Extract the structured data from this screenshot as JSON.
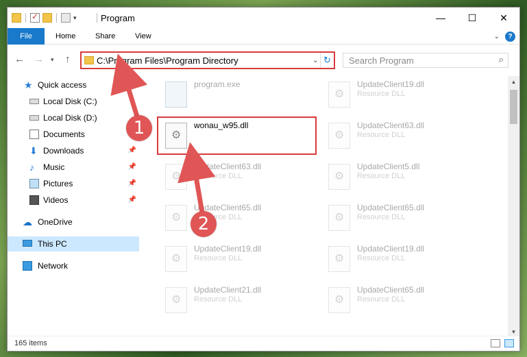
{
  "window": {
    "title": "Program",
    "controls": {
      "minimize": "—",
      "maximize": "☐",
      "close": "✕"
    }
  },
  "ribbon": {
    "tabs": [
      "File",
      "Home",
      "Share",
      "View"
    ],
    "help": "?"
  },
  "address": {
    "path": "C:\\Program Files\\Program Directory",
    "search_placeholder": "Search Program"
  },
  "nav_pane": {
    "items": [
      {
        "label": "Quick access",
        "icon": "star-icon",
        "pinned": false
      },
      {
        "label": "Local Disk (C:)",
        "icon": "drive-icon",
        "pinned": false
      },
      {
        "label": "Local Disk (D:)",
        "icon": "drive-icon",
        "pinned": false
      },
      {
        "label": "Documents",
        "icon": "documents-icon",
        "pinned": false
      },
      {
        "label": "Downloads",
        "icon": "download-icon",
        "pinned": true
      },
      {
        "label": "Music",
        "icon": "music-icon",
        "pinned": true
      },
      {
        "label": "Pictures",
        "icon": "pictures-icon",
        "pinned": true
      },
      {
        "label": "Videos",
        "icon": "videos-icon",
        "pinned": true
      },
      {
        "label": "OneDrive",
        "icon": "cloud-icon",
        "pinned": false
      },
      {
        "label": "This PC",
        "icon": "pc-icon",
        "pinned": false,
        "selected": true
      },
      {
        "label": "Network",
        "icon": "network-icon",
        "pinned": false
      }
    ]
  },
  "files": {
    "left": [
      {
        "name": "program.exe",
        "type": ""
      },
      {
        "name": "wonau_w95.dll",
        "type": ""
      },
      {
        "name": "UpdateClient63.dll",
        "type": "Resource DLL"
      },
      {
        "name": "UpdateClient65.dll",
        "type": "Resource DLL"
      },
      {
        "name": "UpdateClient19.dll",
        "type": "Resource DLL"
      },
      {
        "name": "UpdateClient21.dll",
        "type": "Resource DLL"
      }
    ],
    "right": [
      {
        "name": "UpdateClient19.dll",
        "type": "Resource DLL"
      },
      {
        "name": "UpdateClient63.dll",
        "type": "Resource DLL"
      },
      {
        "name": "UpdateClient5.dll",
        "type": "Resource DLL"
      },
      {
        "name": "UpdateClient65.dll",
        "type": "Resource DLL"
      },
      {
        "name": "UpdateClient19.dll",
        "type": "Resource DLL"
      },
      {
        "name": "UpdateClient65.dll",
        "type": "Resource DLL"
      }
    ]
  },
  "status": {
    "count": "165 items"
  },
  "annotations": {
    "step1": "1",
    "step2": "2",
    "color": "#e05555"
  }
}
